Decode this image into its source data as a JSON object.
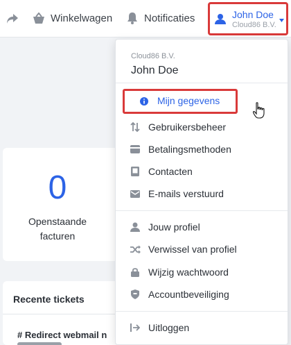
{
  "topbar": {
    "share_icon": "share-arrow-icon",
    "cart_label": "Winkelwagen",
    "notifications_label": "Notificaties",
    "user_name": "John Doe",
    "user_company": "Cloud86 B.V."
  },
  "dashboard": {
    "open_invoices_count": "0",
    "open_invoices_label_line1": "Openstaande",
    "open_invoices_label_line2": "facturen",
    "recent_tickets_title": "Recente tickets",
    "ticket_1_subject": "# Redirect webmail n"
  },
  "dropdown": {
    "company": "Cloud86 B.V.",
    "name": "John Doe",
    "items": [
      {
        "label": "Mijn gegevens",
        "icon": "info-icon"
      },
      {
        "label": "Gebruikersbeheer",
        "icon": "sort-users-icon"
      },
      {
        "label": "Betalingsmethoden",
        "icon": "wallet-icon"
      },
      {
        "label": "Contacten",
        "icon": "contact-book-icon"
      },
      {
        "label": "E-mails verstuurd",
        "icon": "envelope-icon"
      },
      {
        "label": "Jouw profiel",
        "icon": "user-icon"
      },
      {
        "label": "Verwissel van profiel",
        "icon": "shuffle-icon"
      },
      {
        "label": "Wijzig wachtwoord",
        "icon": "lock-icon"
      },
      {
        "label": "Accountbeveiliging",
        "icon": "shield-icon"
      },
      {
        "label": "Uitloggen",
        "icon": "logout-icon"
      }
    ]
  },
  "colors": {
    "accent": "#2c63e6",
    "highlight_border": "#d93a3a"
  }
}
